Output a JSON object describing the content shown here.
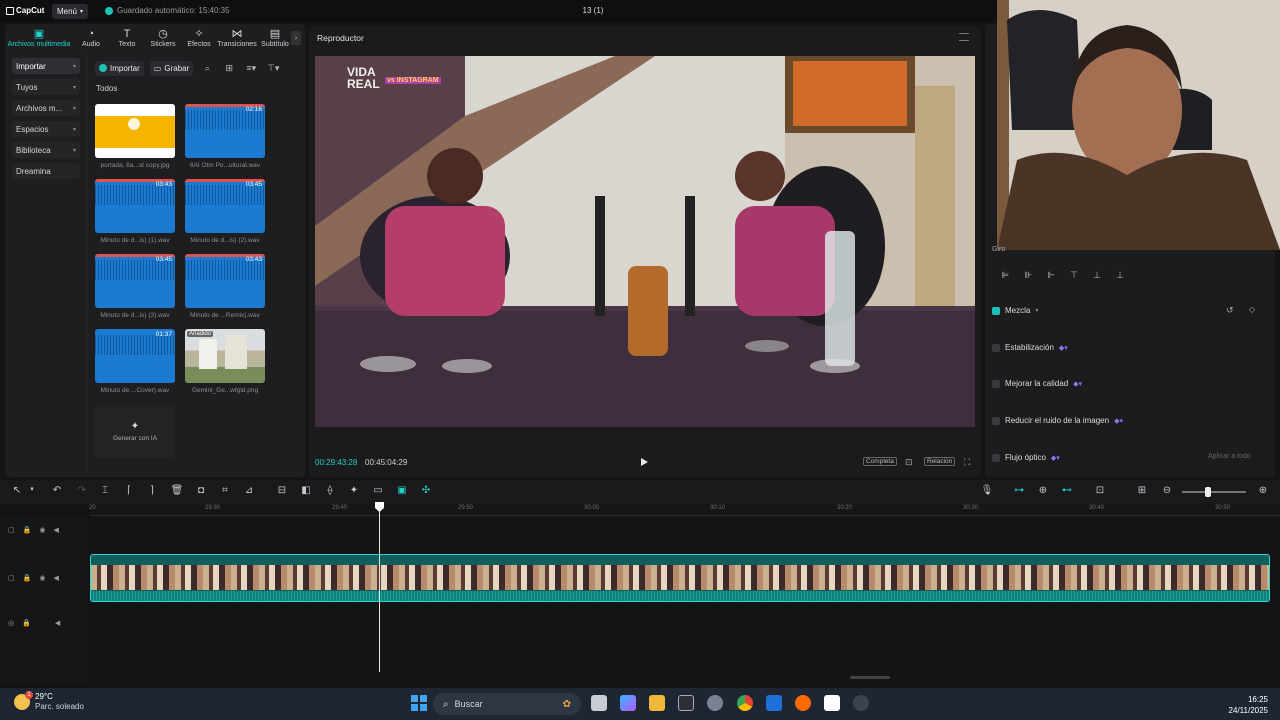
{
  "topbar": {
    "app_name": "CapCut",
    "menu_label": "Menú",
    "autosave": "Guardado automático: 15:40:35",
    "project_title": "13 (1)"
  },
  "media": {
    "tabs": [
      {
        "label": "Archivos multimedia",
        "icon": "media-icon"
      },
      {
        "label": "Audio",
        "icon": "audio-icon"
      },
      {
        "label": "Texto",
        "icon": "text-icon"
      },
      {
        "label": "Stickers",
        "icon": "sticker-icon"
      },
      {
        "label": "Efectos",
        "icon": "effects-icon"
      },
      {
        "label": "Transiciones",
        "icon": "transitions-icon"
      },
      {
        "label": "Subtítulo",
        "icon": "subtitle-icon"
      }
    ],
    "categories": [
      "Importar",
      "Tuyos",
      "Archivos m...",
      "Espacios",
      "Biblioteca",
      "Dreamina"
    ],
    "import_label": "Importar",
    "record_label": "Grabar",
    "all_label": "Todos",
    "items": [
      {
        "caption": "portada, 8a...st copy.jpg",
        "duration": "",
        "kind": "image-yellow"
      },
      {
        "caption": "8AI Otm Po...ultural.wav",
        "duration": "02:16",
        "kind": "audio"
      },
      {
        "caption": "Minuto de d...is) (1).wav",
        "duration": "03:43",
        "kind": "audio"
      },
      {
        "caption": "Minuto de d...is) (2).wav",
        "duration": "03:45",
        "kind": "audio"
      },
      {
        "caption": "Minuto de d...is) (3).wav",
        "duration": "03:45",
        "kind": "audio"
      },
      {
        "caption": "Minuto de ...Remix).wav",
        "duration": "03:43",
        "kind": "audio"
      },
      {
        "caption": "Minuto de ...Cover).wav",
        "duration": "01:37",
        "kind": "audio"
      },
      {
        "caption": "Gemini_Ge...wfgld.png",
        "duration": "",
        "kind": "image-photo",
        "badge": "Añadido"
      }
    ],
    "generate_label": "Generar con IA"
  },
  "player": {
    "title": "Reproductor",
    "time_current": "00:29:43:28",
    "time_total": "00:45:04:29",
    "btn_complete": "Completa",
    "btn_ratio": "Relación",
    "overlay_text": "VIDA REAL",
    "overlay_sub": "vs INSTAGRAM"
  },
  "right": {
    "giro_label": "Giro",
    "props": [
      {
        "label": "Mezcla",
        "on": true
      },
      {
        "label": "Estabilización",
        "on": false
      },
      {
        "label": "Mejorar la calidad",
        "on": false
      },
      {
        "label": "Reducir el ruido de la imagen",
        "on": false
      },
      {
        "label": "Flujo óptico",
        "on": false
      }
    ],
    "apply_all": "Aplicar a todo"
  },
  "timeline": {
    "ticks": [
      "20",
      "29:30",
      "29:40",
      "29:50",
      "30:00",
      "30:10",
      "30:20",
      "30:30",
      "30:40",
      "30:50"
    ]
  },
  "taskbar": {
    "temp": "29°C",
    "weather": "Parc. soleado",
    "weather_badge": "1",
    "search_placeholder": "Buscar",
    "time": "16:25",
    "date": "24/11/2025"
  },
  "colors": {
    "accent": "#1fd1c7",
    "audio_thumb": "#1b7bd1",
    "clip_border": "#2bd9cf"
  }
}
